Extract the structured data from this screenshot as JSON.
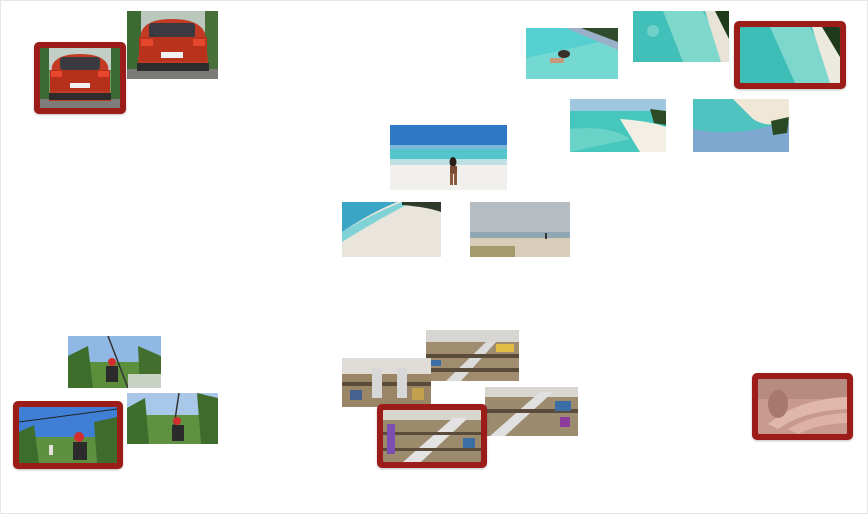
{
  "canvas": {
    "background": "#ffffff",
    "selection_color": "#9c1c1a"
  },
  "clusters": [
    {
      "name": "car",
      "items": [
        "car-rear-photo",
        "car-rear-photo-selected"
      ]
    },
    {
      "name": "beach",
      "items": [
        "beach-swimmer",
        "beach-aerial",
        "beach-aerial-selected",
        "beach-shoreline",
        "beach-tilted",
        "beach-woman-walking",
        "beach-sand-wide",
        "beach-cloudy"
      ]
    },
    {
      "name": "zipline",
      "items": [
        "zipline-man",
        "zipline-man-2",
        "zipline-man-selected"
      ]
    },
    {
      "name": "mall",
      "items": [
        "mall-atrium",
        "mall-escalator",
        "mall-interior",
        "mall-escalator-2",
        "mall-escalator-selected"
      ]
    },
    {
      "name": "hand",
      "items": [
        "hand-closeup-selected"
      ]
    }
  ],
  "selected_count": 5
}
